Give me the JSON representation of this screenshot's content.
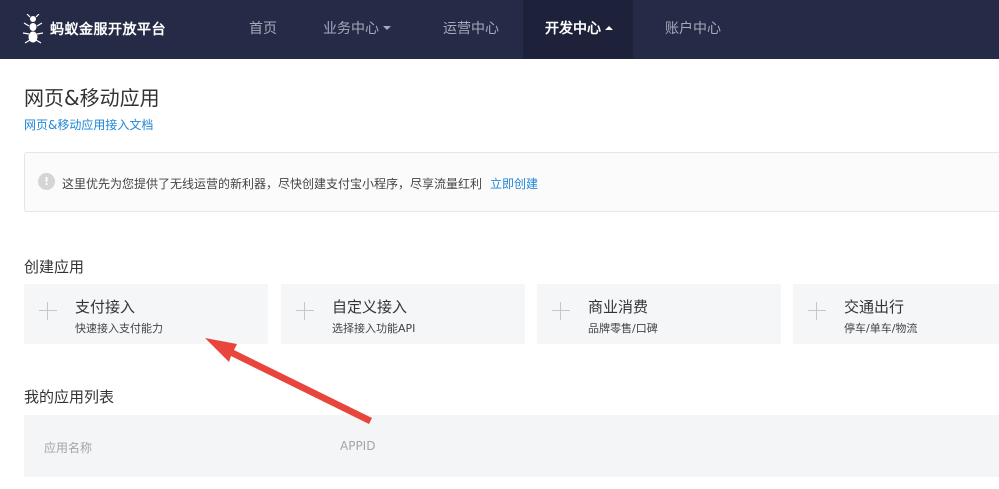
{
  "header": {
    "brand": "蚂蚁金服开放平台",
    "nav": [
      {
        "label": "首页"
      },
      {
        "label": "业务中心"
      },
      {
        "label": "运营中心"
      },
      {
        "label": "开发中心"
      },
      {
        "label": "账户中心"
      }
    ],
    "active_nav": "开发中心"
  },
  "page": {
    "title": "网页&移动应用",
    "doc_link": "网页&移动应用接入文档"
  },
  "notice": {
    "icon": "info-icon",
    "text": "这里优先为您提供了无线运营的新利器，尽快创建支付宝小程序，尽享流量红利",
    "link": "立即创建"
  },
  "create_section": {
    "title": "创建应用",
    "cards": [
      {
        "title": "支付接入",
        "subtitle": "快速接入支付能力",
        "icon": "plus-icon"
      },
      {
        "title": "自定义接入",
        "subtitle": "选择接入功能API",
        "icon": "plus-icon"
      },
      {
        "title": "商业消费",
        "subtitle": "品牌零售/口碑",
        "icon": "plus-icon"
      },
      {
        "title": "交通出行",
        "subtitle": "停车/单车/物流",
        "icon": "plus-icon"
      }
    ]
  },
  "app_list": {
    "title": "我的应用列表",
    "columns": [
      "应用名称",
      "APPID"
    ]
  },
  "colors": {
    "nav_bg": "#252a47",
    "nav_active_bg": "#1d2139",
    "link": "#1f86d7",
    "annotation_arrow": "#e8453c"
  }
}
